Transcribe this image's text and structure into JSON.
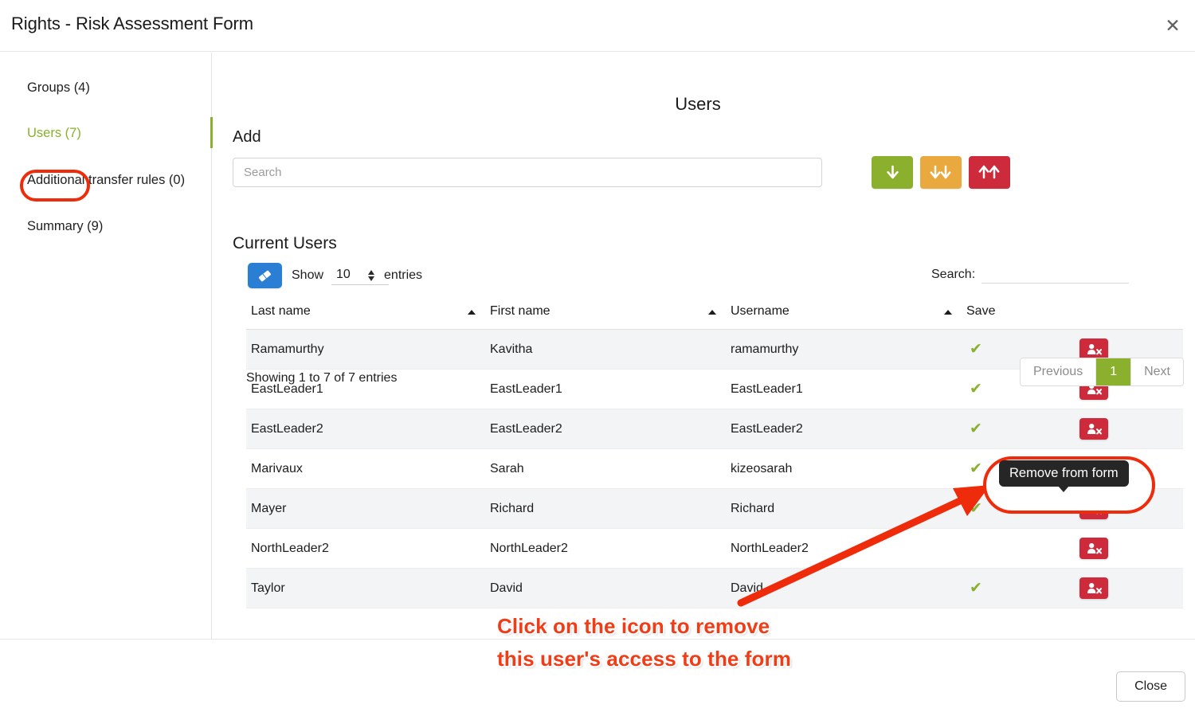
{
  "window": {
    "title": "Rights - Risk Assessment Form",
    "close_icon": "close-x-icon",
    "footer_close_label": "Close"
  },
  "sidebar": {
    "items": [
      {
        "label": "Groups (4)",
        "active": false
      },
      {
        "label": "Users (7)",
        "active": true
      },
      {
        "label": "Additional transfer rules (0)",
        "active": false
      },
      {
        "label": "Summary (9)",
        "active": false
      }
    ],
    "active_color": "#8ab02e",
    "highlight_ring_color": "#ee2b0a"
  },
  "main": {
    "page_title": "Users",
    "add_section": {
      "heading": "Add",
      "search_placeholder": "Search",
      "search_value": "",
      "buttons": [
        {
          "name": "add-single-button",
          "icon": "arrow-down-icon",
          "color": "#8ab02e"
        },
        {
          "name": "add-all-button",
          "icon": "arrow-double-down-icon",
          "color": "#eaa93e"
        },
        {
          "name": "remove-all-button",
          "icon": "arrow-double-up-icon",
          "color": "#cd2b3c"
        }
      ]
    },
    "current_users": {
      "heading": "Current Users",
      "eraser_icon": "eraser-icon",
      "eraser_color": "#2a7fd4",
      "show_label": "Show",
      "entries_value": "10",
      "entries_label": "entries",
      "search_label": "Search:",
      "search_value": "",
      "columns": [
        "Last name",
        "First name",
        "Username",
        "Save",
        ""
      ],
      "rows": [
        {
          "last": "Ramamurthy",
          "first": "Kavitha",
          "username": "ramamurthy",
          "saved": true
        },
        {
          "last": "EastLeader1",
          "first": "EastLeader1",
          "username": "EastLeader1",
          "saved": true
        },
        {
          "last": "EastLeader2",
          "first": "EastLeader2",
          "username": "EastLeader2",
          "saved": true
        },
        {
          "last": "Marivaux",
          "first": "Sarah",
          "username": "kizeosarah",
          "saved": true
        },
        {
          "last": "Mayer",
          "first": "Richard",
          "username": "Richard",
          "saved": true
        },
        {
          "last": "NorthLeader2",
          "first": "NorthLeader2",
          "username": "NorthLeader2",
          "saved": false
        },
        {
          "last": "Taylor",
          "first": "David",
          "username": "David",
          "saved": true
        }
      ],
      "row_action_icon": "user-remove-icon",
      "row_action_color": "#cd2b3c",
      "check_color": "#8ab02e",
      "showing_info": "Showing 1 to 7 of 7 entries",
      "pagination": {
        "previous": "Previous",
        "pages": [
          "1"
        ],
        "current_page": "1",
        "next": "Next",
        "active_color": "#8ab02e"
      }
    }
  },
  "annotation": {
    "tooltip": "Remove from form",
    "callout_line1": "Click on the icon to remove",
    "callout_line2": "this user's access to the form",
    "callout_color": "#f03d17",
    "arrow_color": "#ee2b0a"
  }
}
